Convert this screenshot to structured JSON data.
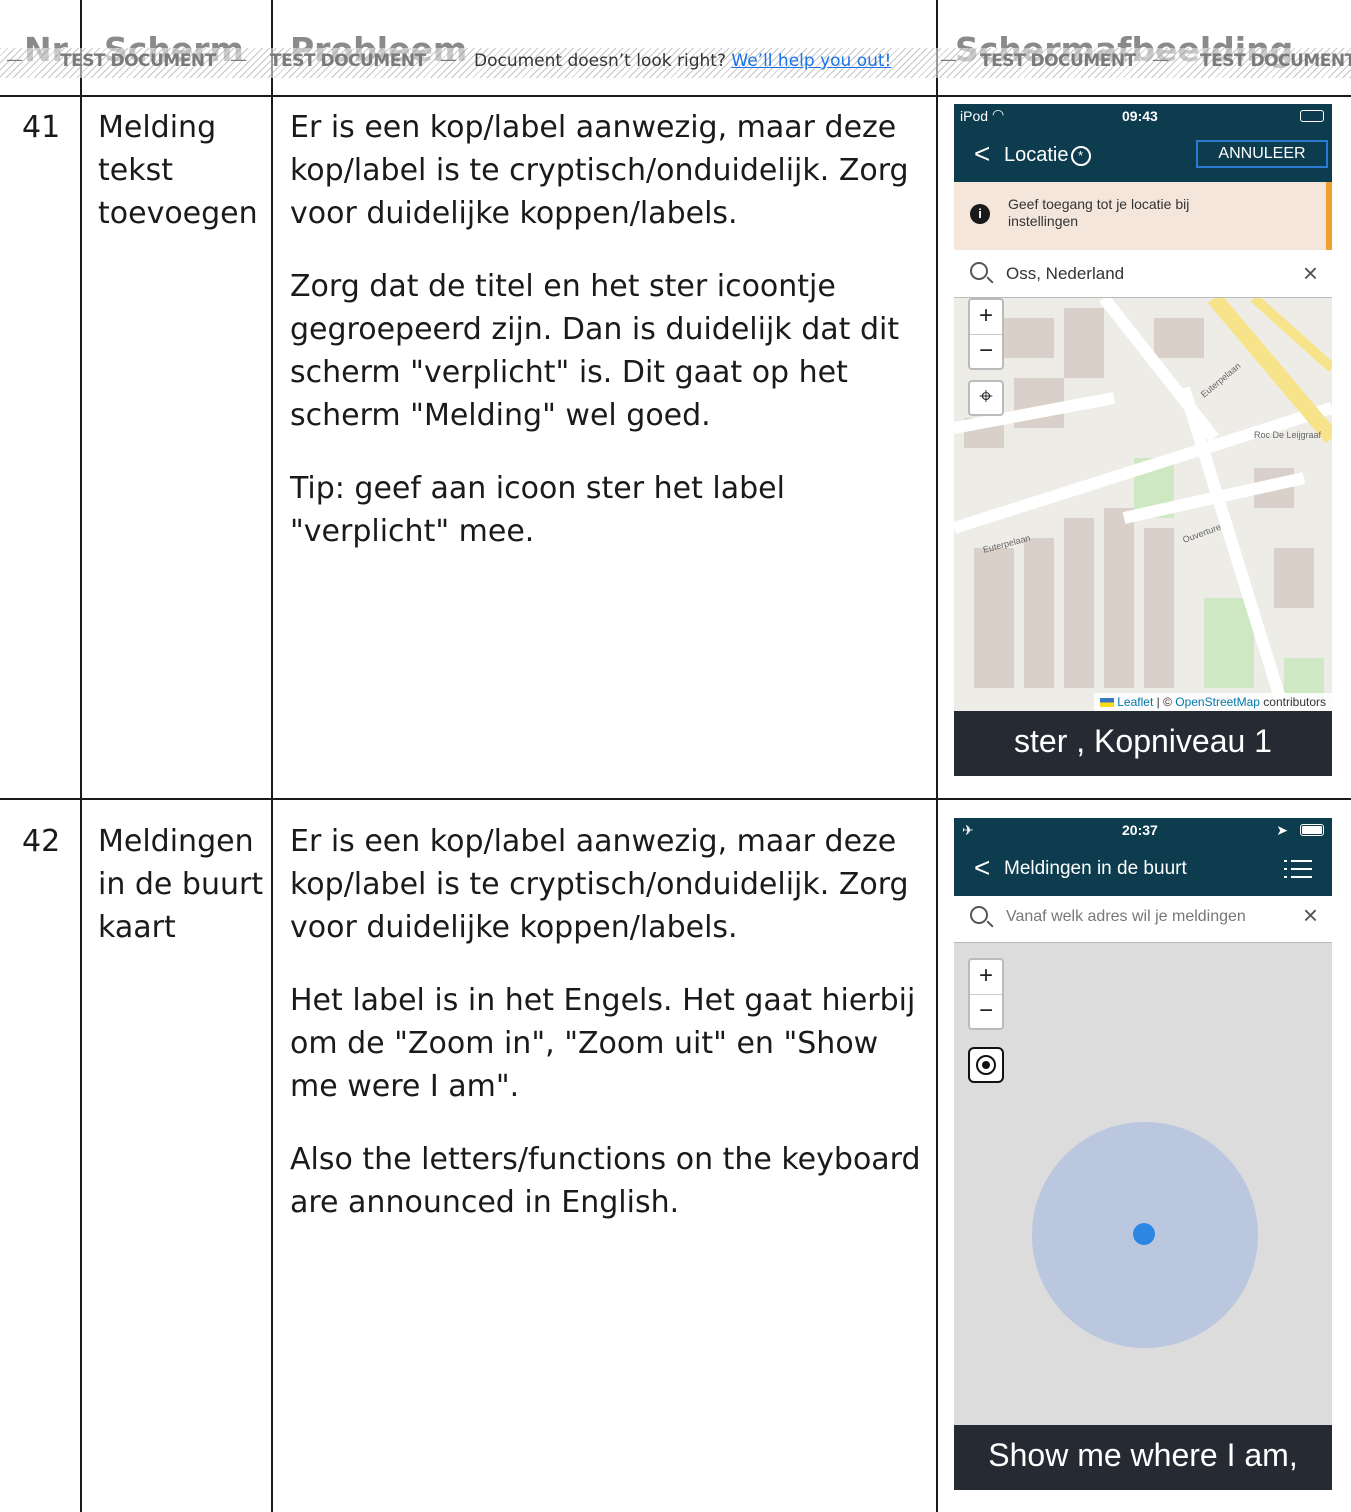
{
  "banner": {
    "watermark": "TEST DOCUMENT",
    "message": "Document doesn’t look right?",
    "link": "We’ll help you out!"
  },
  "table": {
    "headers": [
      "Nr",
      "Scherm",
      "Probleem",
      "Schermafbeelding"
    ],
    "rows": [
      {
        "nr": "41",
        "scherm": "Melding tekst toevoegen",
        "probleem": [
          "Er is een kop/label aanwezig, maar deze kop/label is te cryptisch/onduidelijk. Zorg voor duidelijke koppen/labels.",
          "Zorg dat de titel en het ster icoontje gegroepeerd zijn. Dan is duidelijk dat dit scherm \"verplicht\" is. Dit gaat op het scherm \"Melding\" wel goed.",
          "Tip: geef aan icoon ster het label \"verplicht\" mee."
        ]
      },
      {
        "nr": "42",
        "scherm": "Meldingen in de buurt kaart",
        "probleem": [
          "Er is een kop/label aanwezig, maar deze kop/label is te cryptisch/onduidelijk. Zorg voor duidelijke koppen/labels.",
          "Het label is in het Engels. Het gaat hierbij om de \"Zoom in\", \"Zoom uit\" en \"Show me were I am\".",
          "Also the letters/functions on the keyboard are announced in English."
        ]
      }
    ]
  },
  "screenshot1": {
    "device": "iPod",
    "time": "09:43",
    "back": "<",
    "title": "Locatie",
    "star": "*",
    "cancel": "ANNULEER",
    "warning_icon": "i",
    "warning": "Geef toegang tot je locatie bij instellingen",
    "search_value": "Oss, Nederland",
    "clear": "×",
    "zoom_in": "+",
    "zoom_out": "−",
    "locate": "⌖",
    "street1": "Euterpelaan",
    "street2": "Ouverture",
    "poi": "Roc De Leijgraaf",
    "attribution_leaflet": "Leaflet",
    "attribution_sep": " | © ",
    "attribution_osm": "OpenStreetMap",
    "attribution_rest": " contributors",
    "voiceover_caption": "ster , Kopniveau 1"
  },
  "screenshot2": {
    "airplane": "✈",
    "time": "20:37",
    "location_arrow": "➤",
    "back": "<",
    "title": "Meldingen in de buurt",
    "search_placeholder": "Vanaf welk adres wil je meldingen",
    "clear": "×",
    "zoom_in": "+",
    "zoom_out": "−",
    "voiceover_caption": "Show me where I am,"
  },
  "colors": {
    "app_header": "#0c3c4e",
    "accent_blue": "#2a7bd1",
    "warning_bg": "#f5e6dc",
    "warning_bar": "#f0a030",
    "radius_fill": "#bac7de",
    "location_dot": "#2c86e4",
    "voiceover_bg": "#262a33"
  }
}
